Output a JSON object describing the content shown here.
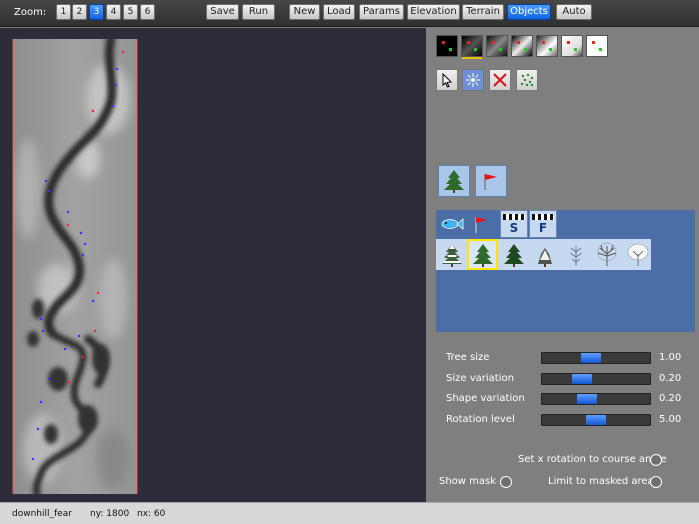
{
  "toolbar": {
    "zoom_label": "Zoom:",
    "zoom_levels": [
      "1",
      "2",
      "3",
      "4",
      "5",
      "6"
    ],
    "zoom_selected": "3",
    "actions": [
      "Save",
      "Run",
      "New",
      "Load",
      "Params",
      "Elevation",
      "Terrain",
      "Objects",
      "Auto"
    ],
    "active_action": "Objects"
  },
  "objects_panel": {
    "category_tabs": {
      "start_label": "S",
      "finish_label": "F"
    }
  },
  "params": [
    {
      "label": "Tree size",
      "value": "1.00",
      "level": 0.45
    },
    {
      "label": "Size variation",
      "value": "0.20",
      "level": 0.37
    },
    {
      "label": "Shape variation",
      "value": "0.20",
      "level": 0.42
    },
    {
      "label": "Rotation level",
      "value": "5.00",
      "level": 0.5
    }
  ],
  "options": {
    "set_x_rotation": "Set x rotation to course angle",
    "show_mask": "Show mask",
    "limit_mask": "Limit to masked area"
  },
  "status": {
    "course_name": "downhill_fear",
    "ny": "ny: 1800",
    "nx": "nx: 60"
  },
  "colors": {
    "accent": "#1a6ee8",
    "selection": "#ffe600",
    "map_border": "#d12222"
  }
}
